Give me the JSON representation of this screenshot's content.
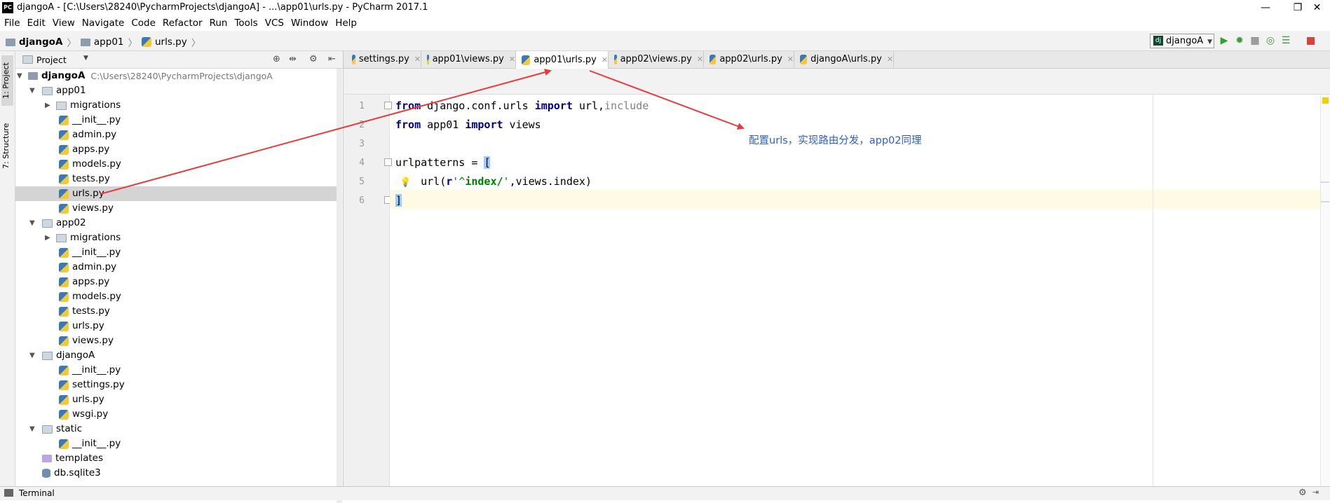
{
  "window": {
    "title": "djangoA - [C:\\Users\\28240\\PycharmProjects\\djangoA] - ...\\app01\\urls.py - PyCharm 2017.1",
    "app_badge": "PC",
    "minimize": "—",
    "restore": "❐",
    "close": "✕"
  },
  "menu": [
    "File",
    "Edit",
    "View",
    "Navigate",
    "Code",
    "Refactor",
    "Run",
    "Tools",
    "VCS",
    "Window",
    "Help"
  ],
  "breadcrumb": {
    "root": "djangoA",
    "folder": "app01",
    "file": "urls.py"
  },
  "run": {
    "config": "djangoA",
    "dj_badge": "dj"
  },
  "left_tools": {
    "project": "1: Project",
    "structure": "7: Structure"
  },
  "project_panel": {
    "label": "Project"
  },
  "tree": [
    {
      "label": "djangoA",
      "hint": "C:\\Users\\28240\\PycharmProjects\\djangoA"
    },
    {
      "label": "app01"
    },
    {
      "label": "migrations"
    },
    {
      "label": "__init__.py"
    },
    {
      "label": "admin.py"
    },
    {
      "label": "apps.py"
    },
    {
      "label": "models.py"
    },
    {
      "label": "tests.py"
    },
    {
      "label": "urls.py"
    },
    {
      "label": "views.py"
    },
    {
      "label": "app02"
    },
    {
      "label": "migrations"
    },
    {
      "label": "__init__.py"
    },
    {
      "label": "admin.py"
    },
    {
      "label": "apps.py"
    },
    {
      "label": "models.py"
    },
    {
      "label": "tests.py"
    },
    {
      "label": "urls.py"
    },
    {
      "label": "views.py"
    },
    {
      "label": "djangoA"
    },
    {
      "label": "__init__.py"
    },
    {
      "label": "settings.py"
    },
    {
      "label": "urls.py"
    },
    {
      "label": "wsgi.py"
    },
    {
      "label": "static"
    },
    {
      "label": "__init__.py"
    },
    {
      "label": "templates"
    },
    {
      "label": "db.sqlite3"
    }
  ],
  "tabs": [
    "settings.py",
    "app01\\views.py",
    "app01\\urls.py",
    "app02\\views.py",
    "app02\\urls.py",
    "djangoA\\urls.py"
  ],
  "code": {
    "line_numbers": [
      "1",
      "2",
      "3",
      "4",
      "5",
      "6"
    ],
    "l1": {
      "kw1": "from",
      "mod": " django.conf.urls ",
      "kw2": "import",
      "names": " url,",
      "unused": "include"
    },
    "l2": {
      "kw1": "from",
      "mod": " app01 ",
      "kw2": "import",
      "names": " views"
    },
    "l4": {
      "text": "urlpatterns = ",
      "bracket": "["
    },
    "l5": {
      "indent": "    ",
      "pre": "url(",
      "prefix": "r",
      "q1": "'",
      "caret": "^",
      "str": "index/",
      "q2": "'",
      "post": ",views.index)"
    },
    "l6": {
      "bracket": "]"
    }
  },
  "annotation": "配置urls，实现路由分发，app02同理",
  "annotation_color": "#2b5fd1",
  "arrow_color": "#e83b3b",
  "bottom": {
    "terminal": "Terminal"
  }
}
